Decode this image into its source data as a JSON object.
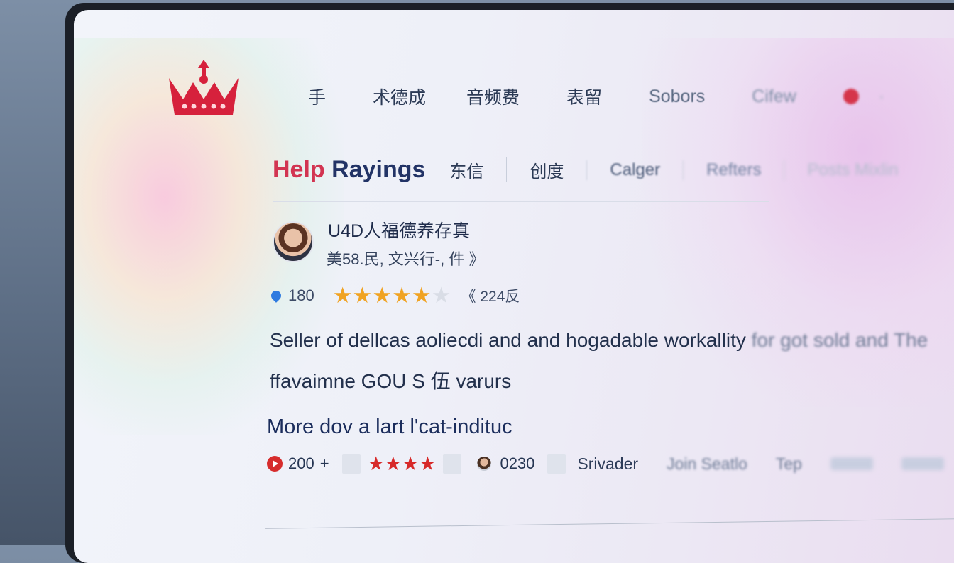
{
  "colors": {
    "brand_red": "#d23451",
    "star_gold": "#f0a323",
    "star_red": "#d72a2a",
    "heading_navy": "#223366",
    "pin_blue": "#2f7be0"
  },
  "logo": {
    "icon": "crown-icon"
  },
  "topnav": {
    "items": [
      "手",
      "术德成",
      "音频费",
      "表留",
      "Sobors",
      "Cifew"
    ]
  },
  "subnav": {
    "title_accent": "Help",
    "title_rest": " Rayings",
    "items": [
      "东信",
      "创度",
      "Calger",
      "Refters",
      "Posts Mixlin"
    ]
  },
  "profile": {
    "name": "U4D人福德养存真",
    "meta": "美58.民, 文兴行-, 件 》",
    "pin_count": "180",
    "rating": 4.5,
    "reviews": "《 224反"
  },
  "description": {
    "line1": "Seller of dellcas aoliecdi and and hogadable workallity",
    "line1_tail": " for got sold and The",
    "line2": "ffavaimne GOU S 伍 varurs"
  },
  "more_heading": "More dov a lart l'cat-indituc",
  "stats": {
    "views": "200",
    "plus": "+",
    "rating": 4,
    "comments": "0230",
    "author": "Srivader",
    "link1": "Join Seatlo",
    "link2": "Tep"
  }
}
